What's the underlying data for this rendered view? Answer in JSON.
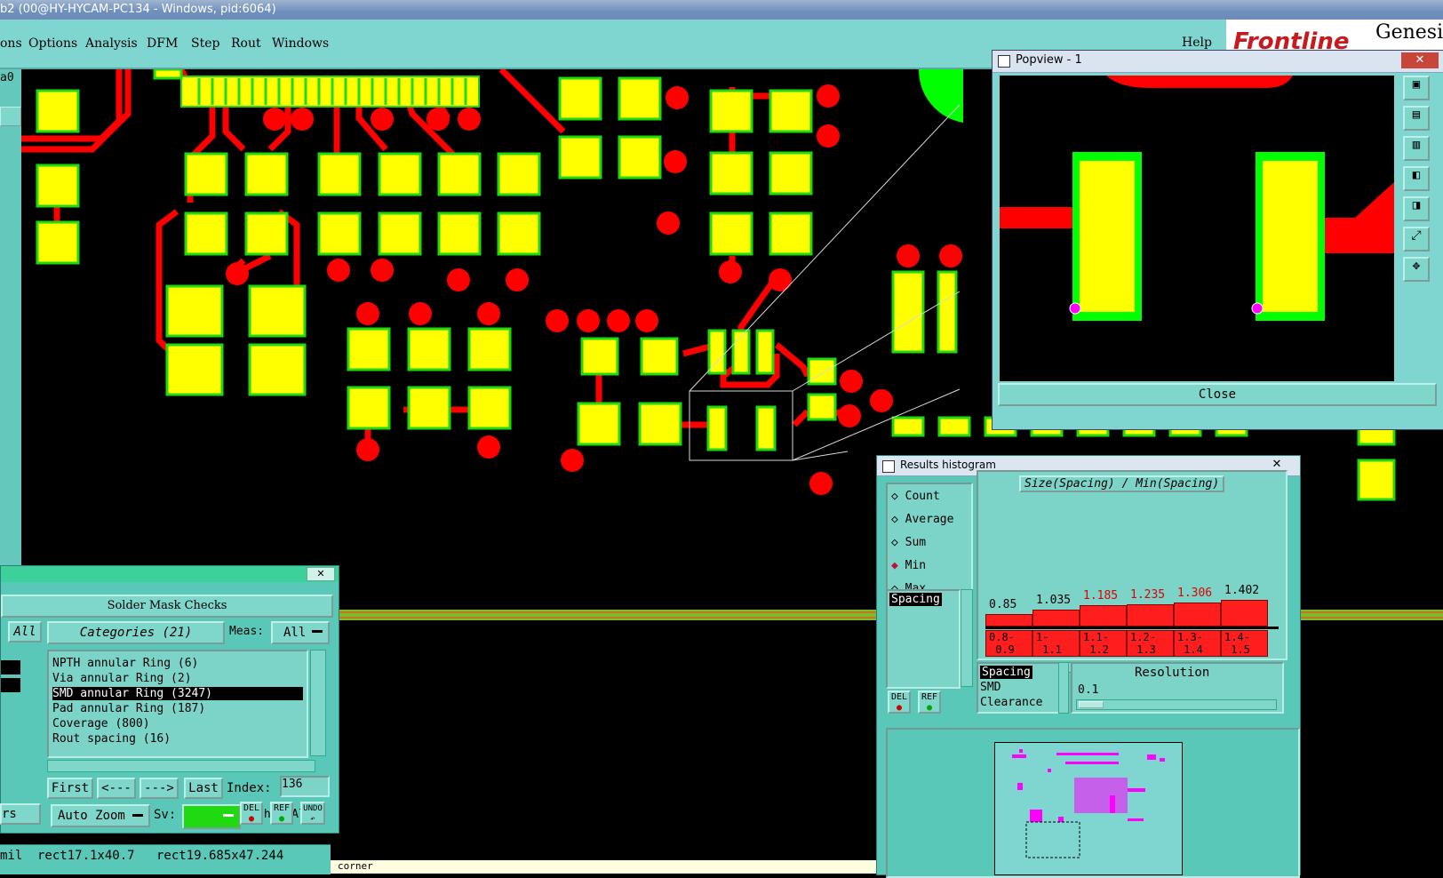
{
  "window_title": "b2 (00@HY-HYCAM-PC134 - Windows, pid:6064)",
  "menu": [
    "ons",
    "Options",
    "Analysis",
    "DFM",
    "Step",
    "Rout",
    "Windows"
  ],
  "help_label": "Help",
  "brand": {
    "frontline": "Frontline",
    "genesis": "Genesis"
  },
  "left_strip_label": "a0",
  "colors": {
    "bg": "#000000",
    "pad_yellow": "#ffff00",
    "pad_green": "#21d911",
    "trace_red": "#ff0000",
    "panel": "#59c8b8",
    "highlight_magenta": "#ff00ff"
  },
  "popview": {
    "title": "Popview - 1",
    "close_label": "Close"
  },
  "solder_mask": {
    "title": "Solder Mask Checks",
    "all_label": "All",
    "categories_label": "Categories (21)",
    "meas_label": "Meas:",
    "meas_value": "All",
    "items": [
      "NPTH annular Ring (6)",
      "Via annular Ring (2)",
      "SMD annular Ring (3247)",
      "Pad annular Ring (187)",
      "Coverage (800)",
      "Rout spacing (16)"
    ],
    "selected_index": 2,
    "first_label": "First",
    "prev_label": "<---",
    "next_label": "--->",
    "last_label": "Last",
    "index_label": "Index:",
    "index_value": "136",
    "auto_zoom_label": "Auto Zoom",
    "sv_label": "Sv:",
    "show_all_label": "Show All",
    "del_label": "DEL",
    "ref_label": "REF",
    "undo_label": "UNDO",
    "left_label": "rs"
  },
  "status_bar": {
    "units": "mil",
    "rect1": "rect17.1x40.7",
    "rect2": "rect19.685x47.244",
    "bottom_text": "corner"
  },
  "histogram": {
    "title": "Results histogram",
    "options": [
      "Count",
      "Average",
      "Sum",
      "Min",
      "Max"
    ],
    "selected_option": "Min",
    "left_list": [
      "Spacing"
    ],
    "chart_title": "Size(Spacing) / Min(Spacing)",
    "bins": [
      {
        "value": "0.85",
        "range": [
          "0.8-",
          "0.9"
        ],
        "red": false
      },
      {
        "value": "1.035",
        "range": [
          "1-",
          "1.1"
        ],
        "red": false
      },
      {
        "value": "1.185",
        "range": [
          "1.1-",
          "1.2"
        ],
        "red": true
      },
      {
        "value": "1.235",
        "range": [
          "1.2-",
          "1.3"
        ],
        "red": true
      },
      {
        "value": "1.306",
        "range": [
          "1.3-",
          "1.4"
        ],
        "red": true
      },
      {
        "value": "1.402",
        "range": [
          "1.4-",
          "1.5"
        ],
        "red": false
      }
    ],
    "bottom_list": [
      "Spacing",
      "SMD",
      "Clearance"
    ],
    "resolution_label": "Resolution",
    "resolution_value": "0.1",
    "del_label": "DEL",
    "ref_label": "REF"
  }
}
